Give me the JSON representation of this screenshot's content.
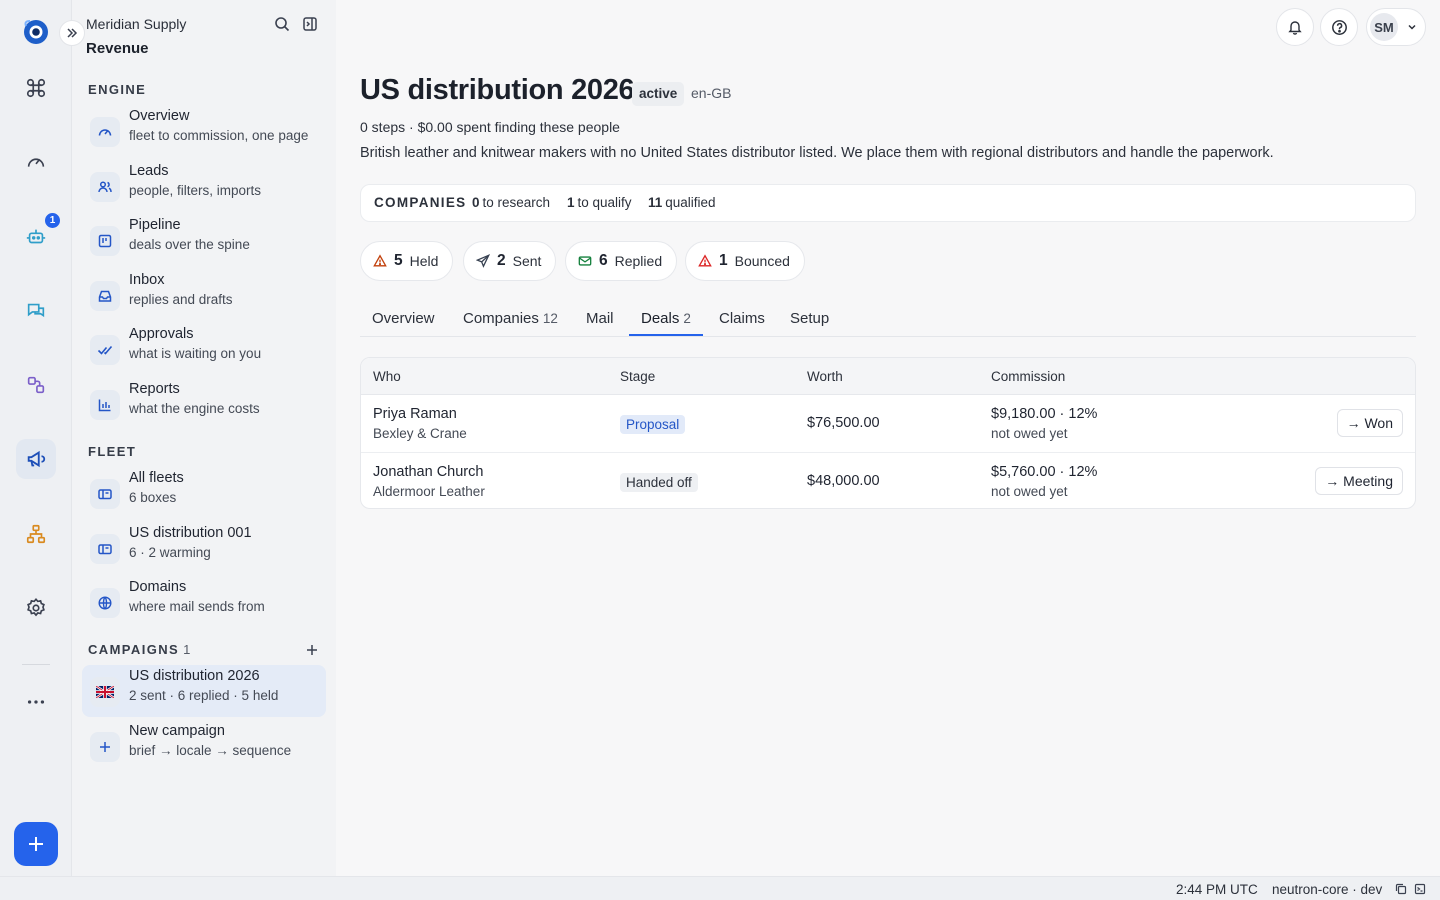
{
  "sidebar": {
    "org_name": "Meridian Supply",
    "workspace": "Revenue",
    "sections": {
      "engine": "ENGINE",
      "fleet": "FLEET",
      "campaigns": "CAMPAIGNS",
      "campaigns_count": "1"
    },
    "engine_items": [
      {
        "title": "Overview",
        "sub": "fleet to commission, one page",
        "icon": "gauge-icon"
      },
      {
        "title": "Leads",
        "sub": "people, filters, imports",
        "icon": "people-icon"
      },
      {
        "title": "Pipeline",
        "sub": "deals over the spine",
        "icon": "kanban-icon"
      },
      {
        "title": "Inbox",
        "sub": "replies and drafts",
        "icon": "inbox-icon"
      },
      {
        "title": "Approvals",
        "sub": "what is waiting on you",
        "icon": "double-check-icon"
      },
      {
        "title": "Reports",
        "sub": "what the engine costs",
        "icon": "bar-chart-icon"
      }
    ],
    "fleet_items": [
      {
        "title": "All fleets",
        "sub": "6 boxes",
        "icon": "mailboxes-icon"
      },
      {
        "title": "US distribution 001",
        "sub": "6 · 2 warming",
        "icon": "mailbox-icon"
      },
      {
        "title": "Domains",
        "sub": "where mail sends from",
        "icon": "globe-icon"
      }
    ],
    "campaign_items": [
      {
        "title": "US distribution 2026",
        "sub": "2 sent · 6 replied · 5 held",
        "icon": "uk-flag-icon"
      },
      {
        "title": "New campaign",
        "sub": "brief → locale → sequence",
        "icon": "plus-icon"
      }
    ]
  },
  "rail": {
    "bot_badge": "1"
  },
  "header": {
    "avatar_initials": "SM"
  },
  "campaign": {
    "title": "US distribution 2026",
    "status": "active",
    "locale": "en-GB",
    "meta": "0 steps · $0.00 spent finding these people",
    "description": "British leather and knitwear makers with no United States distributor listed. We place them with regional distributors and handle the paperwork."
  },
  "companies": {
    "label": "COMPANIES",
    "to_research": "0",
    "to_research_label": "to research",
    "to_qualify": "1",
    "to_qualify_label": "to qualify",
    "qualified": "11",
    "qualified_label": "qualified"
  },
  "stats": [
    {
      "num": "5",
      "label": "Held",
      "icon": "warning-icon",
      "color": "#c2410c"
    },
    {
      "num": "2",
      "label": "Sent",
      "icon": "send-icon",
      "color": "#374151"
    },
    {
      "num": "6",
      "label": "Replied",
      "icon": "mail-icon",
      "color": "#15803d"
    },
    {
      "num": "1",
      "label": "Bounced",
      "icon": "warning-icon",
      "color": "#dc2626"
    }
  ],
  "tabs": [
    {
      "label": "Overview",
      "count": ""
    },
    {
      "label": "Companies",
      "count": "12"
    },
    {
      "label": "Mail",
      "count": ""
    },
    {
      "label": "Deals",
      "count": "2"
    },
    {
      "label": "Claims",
      "count": ""
    },
    {
      "label": "Setup",
      "count": ""
    }
  ],
  "deals": {
    "columns": [
      "Who",
      "Stage",
      "Worth",
      "Commission"
    ],
    "rows": [
      {
        "name": "Priya Raman",
        "company": "Bexley & Crane",
        "stage": "Proposal",
        "worth": "$76,500.00",
        "commission": "$9,180.00 · 12%",
        "commission_note": "not owed yet",
        "action": "→ Won"
      },
      {
        "name": "Jonathan Church",
        "company": "Aldermoor Leather",
        "stage": "Handed off",
        "worth": "$48,000.00",
        "commission": "$5,760.00 · 12%",
        "commission_note": "not owed yet",
        "action": "→ Meeting"
      }
    ]
  },
  "statusbar": {
    "time": "2:44 PM UTC",
    "env": "neutron-core · dev"
  },
  "colors": {
    "accent": "#2563eb"
  }
}
